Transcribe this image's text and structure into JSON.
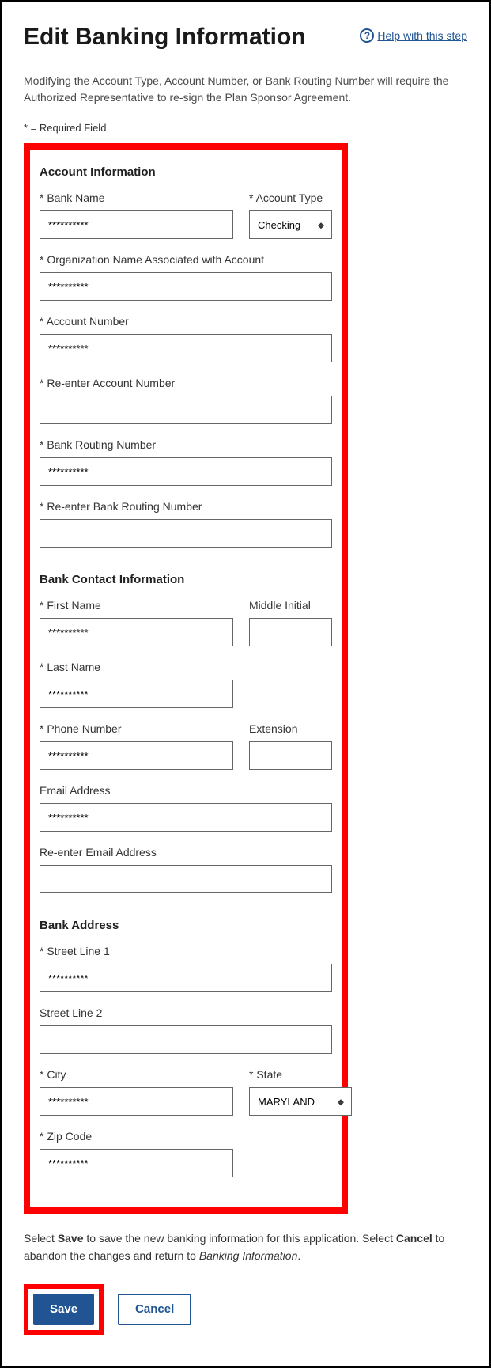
{
  "header": {
    "title": "Edit Banking Information",
    "help_label": " Help with this step"
  },
  "intro_text": "Modifying the Account Type, Account Number, or Bank Routing Number will require the Authorized Representative to re-sign the Plan Sponsor Agreement.",
  "required_note": "* = Required Field",
  "sections": {
    "account_info": {
      "title": "Account Information",
      "bank_name_label": "* Bank Name",
      "bank_name_value": "**********",
      "account_type_label": "* Account Type",
      "account_type_value": "Checking",
      "org_name_label": "* Organization Name Associated with Account",
      "org_name_value": "**********",
      "account_number_label": "* Account Number",
      "account_number_value": "**********",
      "reenter_account_number_label": "* Re-enter Account Number",
      "reenter_account_number_value": "",
      "routing_label": "* Bank Routing Number",
      "routing_value": "**********",
      "reenter_routing_label": "* Re-enter Bank Routing Number",
      "reenter_routing_value": ""
    },
    "contact": {
      "title": "Bank Contact Information",
      "first_name_label": "* First Name",
      "first_name_value": "**********",
      "middle_initial_label": "Middle Initial",
      "middle_initial_value": "",
      "last_name_label": "* Last Name",
      "last_name_value": "**********",
      "phone_label": "* Phone Number",
      "phone_value": "**********",
      "extension_label": "Extension",
      "extension_value": "",
      "email_label": "Email Address",
      "email_value": "**********",
      "reenter_email_label": "Re-enter Email Address",
      "reenter_email_value": ""
    },
    "address": {
      "title": "Bank Address",
      "street1_label": "* Street Line 1",
      "street1_value": "**********",
      "street2_label": "Street Line 2",
      "street2_value": "",
      "city_label": "* City",
      "city_value": "**********",
      "state_label": "* State",
      "state_value": "MARYLAND",
      "zip_label": "* Zip Code",
      "zip_value": "**********"
    }
  },
  "instructions": {
    "pre": "Select ",
    "save_word": "Save",
    "mid1": " to save the new banking information for this application. Select ",
    "cancel_word": "Cancel",
    "mid2": " to abandon the changes and return to ",
    "return_to": "Banking Information",
    "end": "."
  },
  "buttons": {
    "save": "Save",
    "cancel": "Cancel"
  }
}
